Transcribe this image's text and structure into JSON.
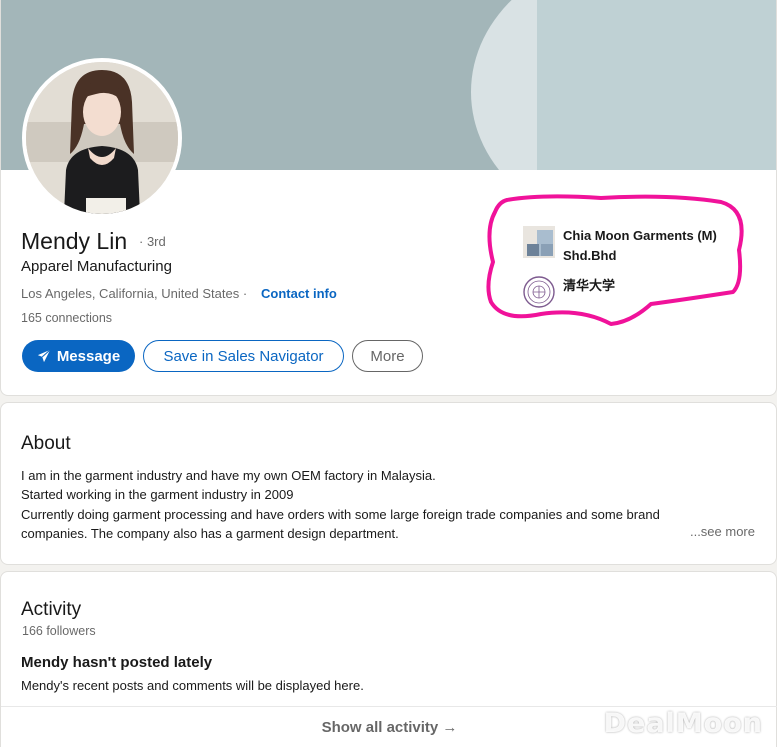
{
  "profile": {
    "name": "Mendy Lin",
    "degree": "· 3rd",
    "headline": "Apparel Manufacturing",
    "location": "Los Angeles, California, United States ·",
    "contact_info": "Contact info",
    "connections": "165 connections",
    "actions": {
      "message": "Message",
      "sales_navigator": "Save in Sales Navigator",
      "more": "More"
    },
    "experience": [
      {
        "label": "Chia Moon Garments (M) Shd.Bhd",
        "icon": "company-logo-icon"
      },
      {
        "label": "清华大学",
        "icon": "university-seal-icon"
      }
    ]
  },
  "about": {
    "title": "About",
    "lines": [
      "I am in the garment industry and have my own OEM factory in Malaysia.",
      "Started working in the garment industry in 2009",
      "Currently doing garment processing and have orders with some large foreign trade companies and some brand companies. The company also has a garment design department."
    ],
    "see_more": "...see more"
  },
  "activity": {
    "title": "Activity",
    "followers": "166 followers",
    "empty_title": "Mendy hasn't posted lately",
    "empty_text": "Mendy's recent posts and comments will be displayed here.",
    "show_all": "Show all activity →"
  },
  "watermark": "DealMoon",
  "colors": {
    "primary": "#0a66c2",
    "highlight": "#f0129a",
    "cover": "#a3b6b9"
  }
}
